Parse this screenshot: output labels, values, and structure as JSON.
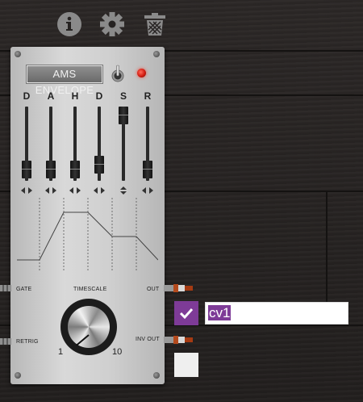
{
  "toolbar": {
    "icons": [
      "info-icon",
      "gear-icon",
      "trash-icon"
    ]
  },
  "module": {
    "title": "AMS ENVELOPE",
    "sliders": [
      {
        "label": "D",
        "level": 0.15
      },
      {
        "label": "A",
        "level": 0.15
      },
      {
        "label": "H",
        "level": 0.15
      },
      {
        "label": "D",
        "level": 0.22
      },
      {
        "label": "S",
        "level": 0.88
      },
      {
        "label": "R",
        "level": 0.15
      }
    ],
    "gate_label": "GATE",
    "timescale_label": "TIMESCALE",
    "out_label": "OUT",
    "retrig_label": "RETRIG",
    "inv_out_label": "INV OUT",
    "scale_min": "1",
    "scale_max": "10",
    "led_color": "#d11b10"
  },
  "output": {
    "checked": true,
    "name_value": "cv1",
    "accent": "#7e3b97"
  }
}
